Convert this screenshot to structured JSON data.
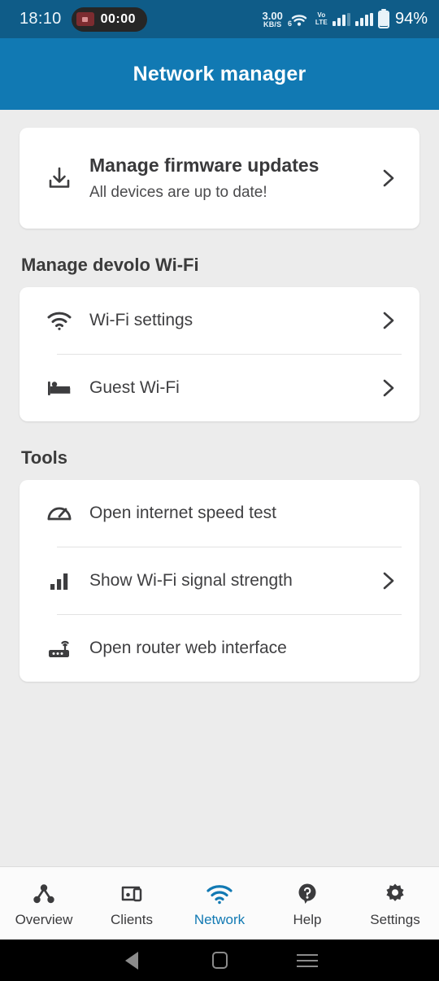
{
  "status_bar": {
    "clock": "18:10",
    "recording_timer": "00:00",
    "recording_icon": "video-camera-icon",
    "net_speed_value": "3.00",
    "net_speed_unit": "KB/S",
    "wifi_icon": "wifi-6-icon",
    "volte_line1": "Vo",
    "volte_line2": "LTE",
    "signal_icon_1": "cellular-signal-icon",
    "signal_icon_2": "cellular-signal-icon",
    "battery_icon": "battery-icon",
    "battery_percent": "94%"
  },
  "app_bar": {
    "title": "Network manager",
    "background_color": "#1179b3"
  },
  "firmware_card": {
    "icon": "download-icon",
    "title": "Manage firmware updates",
    "subtitle": "All devices are up to date!",
    "chevron": "chevron-right-icon"
  },
  "sections": [
    {
      "title": "Manage devolo Wi-Fi",
      "rows": [
        {
          "icon": "wifi-icon",
          "label": "Wi-Fi settings",
          "chevron": true
        },
        {
          "icon": "bed-icon",
          "label": "Guest Wi-Fi",
          "chevron": true
        }
      ]
    },
    {
      "title": "Tools",
      "rows": [
        {
          "icon": "speedometer-icon",
          "label": "Open internet speed test",
          "chevron": false
        },
        {
          "icon": "signal-bars-icon",
          "label": "Show Wi-Fi signal strength",
          "chevron": true
        },
        {
          "icon": "router-icon",
          "label": "Open router web interface",
          "chevron": false
        }
      ]
    }
  ],
  "bottom_nav": {
    "active_color": "#1179b3",
    "inactive_color": "#3b3b3d",
    "items": [
      {
        "icon": "network-topology-icon",
        "label": "Overview",
        "active": false
      },
      {
        "icon": "devices-icon",
        "label": "Clients",
        "active": false
      },
      {
        "icon": "wifi-icon",
        "label": "Network",
        "active": true
      },
      {
        "icon": "help-bubble-icon",
        "label": "Help",
        "active": false
      },
      {
        "icon": "gear-icon",
        "label": "Settings",
        "active": false
      }
    ]
  },
  "system_nav": {
    "back": "back-triangle-icon",
    "home": "home-square-icon",
    "recents": "recents-menu-icon"
  }
}
